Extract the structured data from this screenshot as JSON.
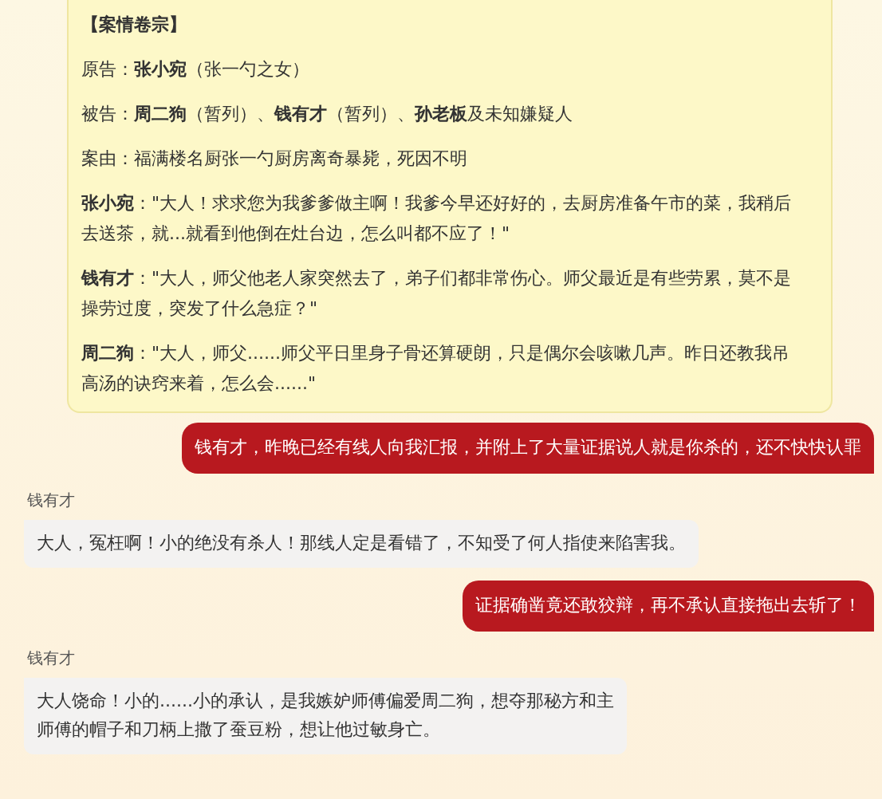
{
  "case_file": {
    "title": "【案情卷宗】",
    "paragraphs": [
      "原告：**张小宛**（张一勺之女）",
      "被告：**周二狗**（暂列）、**钱有才**（暂列）、**孙老板**及未知嫌疑人",
      "案由：福满楼名厨张一勺厨房离奇暴毙，死因不明",
      "**张小宛**：\"大人！求求您为我爹爹做主啊！我爹今早还好好的，去厨房准备午市的菜，我稍后去送茶，就...就看到他倒在灶台边，怎么叫都不应了！\"",
      "**钱有才**：\"大人，师父他老人家突然去了，弟子们都非常伤心。师父最近是有些劳累，莫不是操劳过度，突发了什么急症？\"",
      "**周二狗**：\"大人，师父......师父平日里身子骨还算硬朗，只是偶尔会咳嗽几声。昨日还教我吊高汤的诀窍来着，怎么会......\""
    ]
  },
  "messages": [
    {
      "kind": "outgoing",
      "lines": [
        "钱有才，昨晚已经有线人向我汇报，并附上了大量证据说人就是你杀的，还不快快认罪"
      ]
    },
    {
      "kind": "incoming",
      "sender": "钱有才",
      "lines": [
        "大人，冤枉啊！小的绝没有杀人！那线人定是看错了，不知受了何人指使来陷害我。"
      ]
    },
    {
      "kind": "outgoing",
      "lines": [
        "证据确凿竟还敢狡辩，再不承认直接拖出去斩了！"
      ]
    },
    {
      "kind": "incoming",
      "sender": "钱有才",
      "lines": [
        "大人饶命！小的......小的承认，是我嫉妒师傅偏爱周二狗，想夺那秘方和主",
        "师傅的帽子和刀柄上撒了蚕豆粉，想让他过敏身亡。"
      ]
    }
  ]
}
